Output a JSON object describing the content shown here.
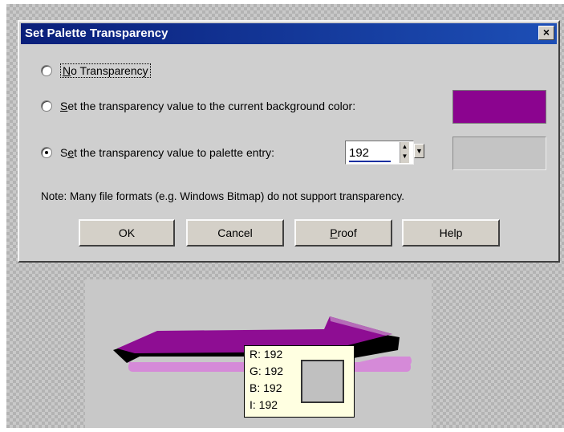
{
  "dialog": {
    "title": "Set Palette Transparency",
    "close_label": "×",
    "options": [
      {
        "label_prefix": "",
        "label_accel": "N",
        "label_rest": "o Transparency",
        "checked": false
      },
      {
        "label_prefix": "",
        "label_accel": "S",
        "label_rest": "et the transparency value to the current background color:",
        "checked": false
      },
      {
        "label_prefix": "S",
        "label_accel": "e",
        "label_rest": "t the transparency value to palette entry:",
        "checked": true
      }
    ],
    "palette_entry_value": "192",
    "background_color": "#8b048f",
    "palette_color": "#c4c4c4",
    "note": "Note: Many file formats (e.g. Windows Bitmap) do not support transparency.",
    "buttons": {
      "ok": "OK",
      "cancel": "Cancel",
      "proof_accel": "P",
      "proof_rest": "roof",
      "help": "Help"
    }
  },
  "tooltip": {
    "r": "R: 192",
    "g": "G: 192",
    "b": "B: 192",
    "i": "I: 192"
  },
  "icons": {
    "close": "close-icon",
    "spin": "spinner-arrows-icon",
    "dropdown": "chevron-down-icon"
  }
}
